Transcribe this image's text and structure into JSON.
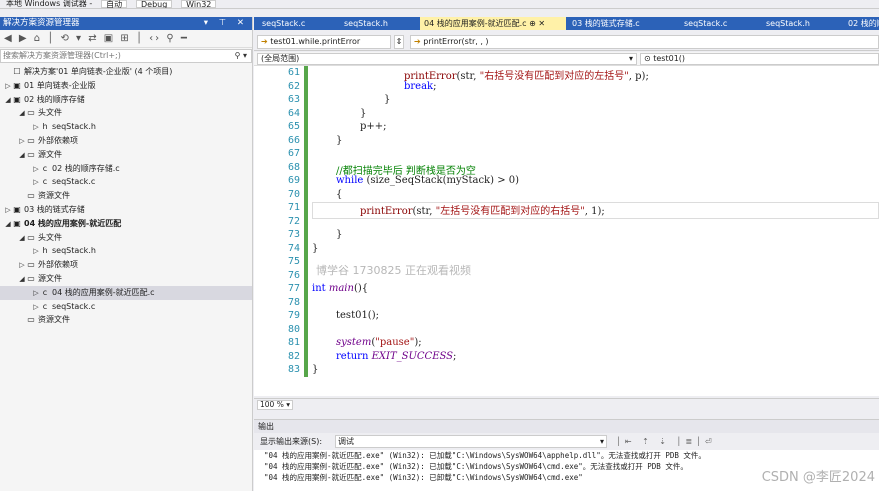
{
  "topbar": {
    "items": [
      "本地 Windows 调试器 -",
      "自动",
      "Debug",
      "Win32"
    ]
  },
  "solution_explorer": {
    "title": "解决方案资源管理器",
    "controls": "▾ ⊤ ✕",
    "search_placeholder": "搜索解决方案资源管理器(Ctrl+;)",
    "rows": [
      {
        "label": "解决方案'01 单向链表-企业版' (4 个项目)",
        "indent": 0,
        "arrow": "",
        "icon": "☐",
        "bold": false,
        "selected": false
      },
      {
        "label": "01 单向链表-企业版",
        "indent": 0,
        "arrow": "▷",
        "icon": "▣",
        "bold": false,
        "selected": false
      },
      {
        "label": "02 栈的顺序存储",
        "indent": 0,
        "arrow": "◢",
        "icon": "▣",
        "bold": false,
        "selected": false
      },
      {
        "label": "头文件",
        "indent": 1,
        "arrow": "◢",
        "icon": "▭",
        "bold": false,
        "selected": false
      },
      {
        "label": "seqStack.h",
        "indent": 2,
        "arrow": "▷",
        "icon": "h",
        "bold": false,
        "selected": false
      },
      {
        "label": "外部依赖项",
        "indent": 1,
        "arrow": "▷",
        "icon": "▭",
        "bold": false,
        "selected": false
      },
      {
        "label": "源文件",
        "indent": 1,
        "arrow": "◢",
        "icon": "▭",
        "bold": false,
        "selected": false
      },
      {
        "label": "02 栈的顺序存储.c",
        "indent": 2,
        "arrow": "▷",
        "icon": "c",
        "bold": false,
        "selected": false
      },
      {
        "label": "seqStack.c",
        "indent": 2,
        "arrow": "▷",
        "icon": "c",
        "bold": false,
        "selected": false
      },
      {
        "label": "资源文件",
        "indent": 1,
        "arrow": "",
        "icon": "▭",
        "bold": false,
        "selected": false
      },
      {
        "label": "03 栈的链式存储",
        "indent": 0,
        "arrow": "▷",
        "icon": "▣",
        "bold": false,
        "selected": false
      },
      {
        "label": "04 栈的应用案例-就近匹配",
        "indent": 0,
        "arrow": "◢",
        "icon": "▣",
        "bold": true,
        "selected": false
      },
      {
        "label": "头文件",
        "indent": 1,
        "arrow": "◢",
        "icon": "▭",
        "bold": false,
        "selected": false
      },
      {
        "label": "seqStack.h",
        "indent": 2,
        "arrow": "▷",
        "icon": "h",
        "bold": false,
        "selected": false
      },
      {
        "label": "外部依赖项",
        "indent": 1,
        "arrow": "▷",
        "icon": "▭",
        "bold": false,
        "selected": false
      },
      {
        "label": "源文件",
        "indent": 1,
        "arrow": "◢",
        "icon": "▭",
        "bold": false,
        "selected": false
      },
      {
        "label": "04 栈的应用案例-就近匹配.c",
        "indent": 2,
        "arrow": "▷",
        "icon": "c",
        "bold": false,
        "selected": true
      },
      {
        "label": "seqStack.c",
        "indent": 2,
        "arrow": "▷",
        "icon": "c",
        "bold": false,
        "selected": false
      },
      {
        "label": "资源文件",
        "indent": 1,
        "arrow": "",
        "icon": "▭",
        "bold": false,
        "selected": false
      }
    ]
  },
  "tabs": [
    {
      "label": "seqStack.c",
      "active": false
    },
    {
      "label": "seqStack.h",
      "active": false
    },
    {
      "label": "04 栈的应用案例-就近匹配.c  ⊕  ✕",
      "active": true
    },
    {
      "label": "03 栈的链式存储.c",
      "active": false
    },
    {
      "label": "seqStack.c",
      "active": false
    },
    {
      "label": "seqStack.h",
      "active": false
    },
    {
      "label": "02 栈的顺",
      "active": false
    }
  ],
  "nav": {
    "left": "test01.while.printError",
    "right": "printError(str, , )",
    "scope": "(全局范围)",
    "scope_right": "test01()"
  },
  "code_lines": [
    {
      "n": "61",
      "html": "<span class=\"fn\">printError</span>(str, <span class=\"str\">\"右括号没有匹配到对应的左括号\"</span>, p);",
      "indent": 92
    },
    {
      "n": "62",
      "html": "<span class=\"kw\">break</span>;",
      "indent": 92
    },
    {
      "n": "63",
      "html": "}",
      "indent": 72
    },
    {
      "n": "64",
      "html": "}",
      "indent": 48
    },
    {
      "n": "65",
      "html": "p++;",
      "indent": 48
    },
    {
      "n": "66",
      "html": "}",
      "indent": 24
    },
    {
      "n": "67",
      "html": "",
      "indent": 24
    },
    {
      "n": "68",
      "html": "<span class=\"cm\">//都扫描完毕后 判断栈是否为空</span>",
      "indent": 24
    },
    {
      "n": "69",
      "html": "<span class=\"kw\">while</span> (size_SeqStack(myStack) > 0)",
      "indent": 24
    },
    {
      "n": "70",
      "html": "{",
      "indent": 24
    },
    {
      "n": "71",
      "html": "<span class=\"fn\">printError</span>(str, <span class=\"str\">\"左括号没有匹配到对应的右括号\"</span>, 1);",
      "indent": 48
    },
    {
      "n": "72",
      "html": "",
      "indent": 24
    },
    {
      "n": "73",
      "html": "}",
      "indent": 24
    },
    {
      "n": "74",
      "html": "}",
      "indent": 0
    },
    {
      "n": "75",
      "html": "",
      "indent": 0
    },
    {
      "n": "76",
      "html": "",
      "indent": 0
    },
    {
      "n": "77",
      "html": "<span class=\"kw\">int</span> <span class=\"mac\">main</span>(){",
      "indent": 0
    },
    {
      "n": "78",
      "html": "",
      "indent": 0
    },
    {
      "n": "79",
      "html": "test01();",
      "indent": 24
    },
    {
      "n": "80",
      "html": "",
      "indent": 0
    },
    {
      "n": "81",
      "html": "<span class=\"mac\">system</span>(<span class=\"str\">\"pause\"</span>);",
      "indent": 24
    },
    {
      "n": "82",
      "html": "<span class=\"kw\">return</span> <span class=\"mac\">EXIT_SUCCESS</span>;",
      "indent": 24
    },
    {
      "n": "83",
      "html": "}",
      "indent": 0
    }
  ],
  "watermark": "博学谷 1730825 正在观看视频",
  "zoom": "100 %",
  "output": {
    "title": "输出",
    "source_label": "显示输出来源(S):",
    "source_value": "调试",
    "lines": [
      "\"04 栈的应用案例-就近匹配.exe\" (Win32):  已加载\"C:\\Windows\\SysWOW64\\apphelp.dll\"。无法查找或打开 PDB 文件。",
      "\"04 栈的应用案例-就近匹配.exe\" (Win32):  已加载\"C:\\Windows\\SysWOW64\\cmd.exe\"。无法查找或打开 PDB 文件。",
      "\"04 栈的应用案例-就近匹配.exe\" (Win32):  已卸载\"C:\\Windows\\SysWOW64\\cmd.exe\""
    ]
  },
  "csdn_watermark": "CSDN @李匠2024"
}
